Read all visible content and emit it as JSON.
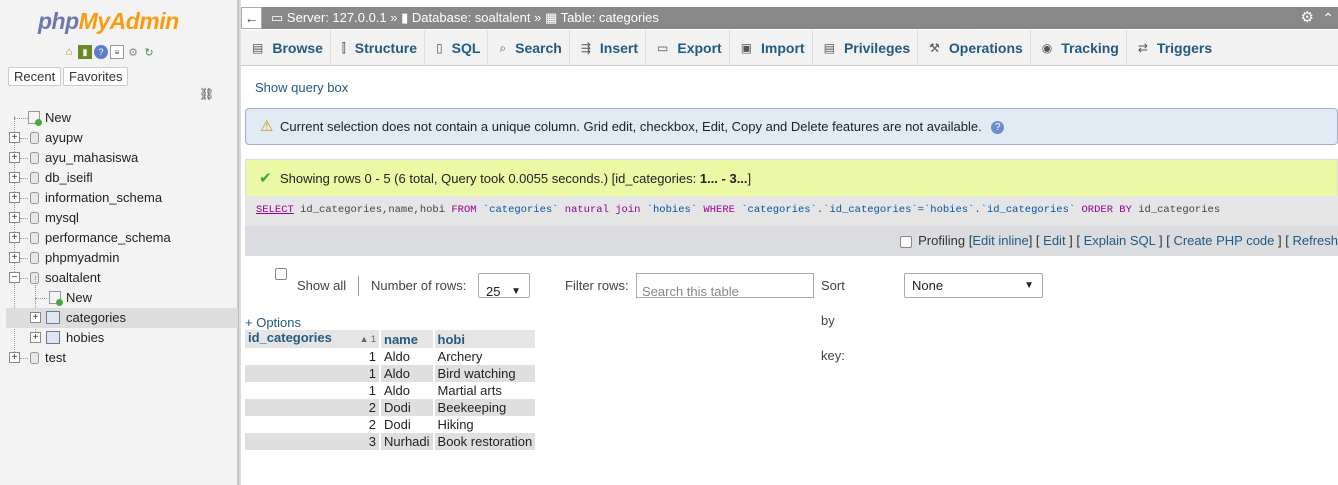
{
  "sidebar": {
    "logo_php": "php",
    "logo_myadmin": "MyAdmin",
    "quick_icons": [
      "home-icon",
      "exit-icon",
      "help-icon",
      "docs-icon",
      "settings-icon",
      "reload-icon"
    ],
    "recent_label": "Recent",
    "favorites_label": "Favorites",
    "tree": {
      "new": "New",
      "databases": [
        "ayupw",
        "ayu_mahasiswa",
        "db_iseifl",
        "information_schema",
        "mysql",
        "performance_schema",
        "phpmyadmin"
      ],
      "current_db": "soaltalent",
      "current_db_new": "New",
      "tables": [
        "categories",
        "hobies"
      ],
      "selected_table": "categories",
      "last_db": "test"
    }
  },
  "topbar": {
    "server_label": "Server: 127.0.0.1",
    "database_label": "Database: soaltalent",
    "table_label": "Table: categories",
    "sep": "»"
  },
  "tabs": [
    {
      "label": "Browse",
      "icon": "browse-icon"
    },
    {
      "label": "Structure",
      "icon": "structure-icon"
    },
    {
      "label": "SQL",
      "icon": "sql-icon"
    },
    {
      "label": "Search",
      "icon": "search-icon"
    },
    {
      "label": "Insert",
      "icon": "insert-icon"
    },
    {
      "label": "Export",
      "icon": "export-icon"
    },
    {
      "label": "Import",
      "icon": "import-icon"
    },
    {
      "label": "Privileges",
      "icon": "privileges-icon"
    },
    {
      "label": "Operations",
      "icon": "operations-icon"
    },
    {
      "label": "Tracking",
      "icon": "tracking-icon"
    },
    {
      "label": "Triggers",
      "icon": "triggers-icon"
    }
  ],
  "show_query_box": "Show query box",
  "notice": "Current selection does not contain a unique column. Grid edit, checkbox, Edit, Copy and Delete features are not available.",
  "success_prefix": "Showing rows 0 - 5 (6 total, Query took 0.0055 seconds.) [id_categories: ",
  "success_range": "1... - 3...",
  "success_suffix": "]",
  "sql": {
    "p1": "SELECT",
    "p2": " id_categories,name,hobi ",
    "p3": "FROM",
    "p4": " `categories` ",
    "p5": "natural join",
    "p6": " `hobies` ",
    "p7": "WHERE",
    "p8": " `categories`.`id_categories`=`hobies`.`id_categories` ",
    "p9": "ORDER BY",
    "p10": " id_categories"
  },
  "profiling": {
    "label": "Profiling",
    "links": [
      "Edit inline",
      "Edit",
      "Explain SQL",
      "Create PHP code",
      "Refresh"
    ]
  },
  "nav": {
    "show_all": "Show all",
    "rows_label": "Number of rows:",
    "rows_value": "25",
    "filter_label": "Filter rows:",
    "filter_placeholder": "Search this table",
    "sort_label": "Sort by key:",
    "sort_value": "None"
  },
  "options_label": "+ Options",
  "table": {
    "columns": [
      "id_categories",
      "name",
      "hobi"
    ],
    "sort_indicator": "▲ 1",
    "rows": [
      [
        "1",
        "Aldo",
        "Archery"
      ],
      [
        "1",
        "Aldo",
        "Bird watching"
      ],
      [
        "1",
        "Aldo",
        "Martial arts"
      ],
      [
        "2",
        "Dodi",
        "Beekeeping"
      ],
      [
        "2",
        "Dodi",
        "Hiking"
      ],
      [
        "3",
        "Nurhadi",
        "Book restoration"
      ]
    ]
  }
}
